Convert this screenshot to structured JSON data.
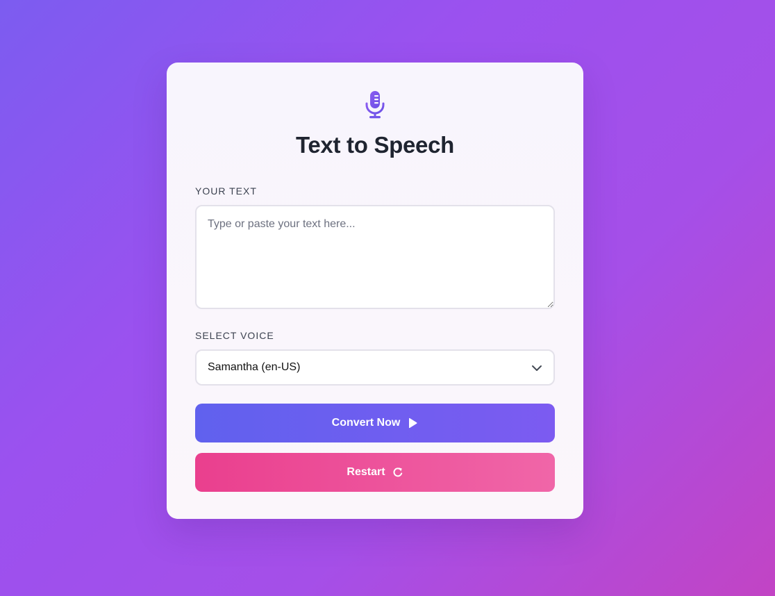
{
  "app": {
    "title": "Text to Speech",
    "icon": "microphone-icon",
    "accent_color": "#7c5bf1"
  },
  "form": {
    "text_label": "YOUR TEXT",
    "text_value": "",
    "text_placeholder": "Type or paste your text here...",
    "voice_label": "SELECT VOICE",
    "voice_selected": "Samantha (en-US)"
  },
  "actions": {
    "convert_label": "Convert Now",
    "convert_icon": "play-icon",
    "convert_color": "#6061ee",
    "restart_label": "Restart",
    "restart_icon": "refresh-icon",
    "restart_color": "#ea3f8e"
  }
}
